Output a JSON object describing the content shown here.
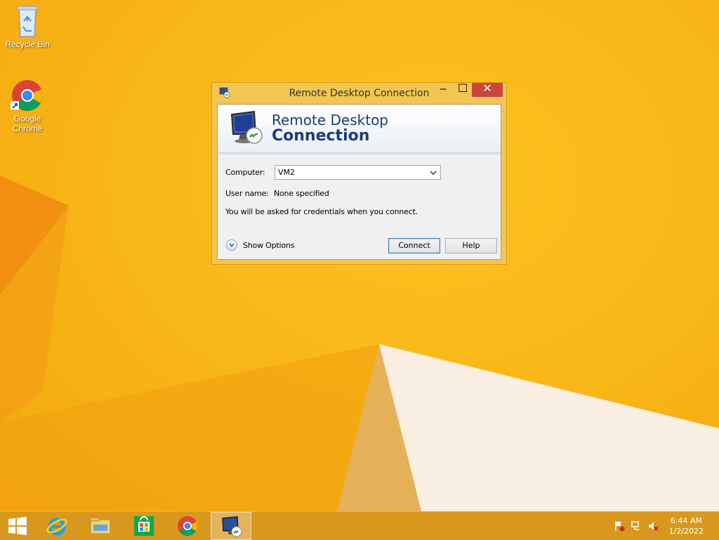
{
  "desktop": {
    "icons": [
      {
        "label": "Recycle Bin",
        "icon": "recycle-bin-icon"
      },
      {
        "label": "Google Chrome",
        "icon": "chrome-icon"
      }
    ]
  },
  "window": {
    "title": "Remote Desktop Connection",
    "banner_line1": "Remote Desktop",
    "banner_line2": "Connection",
    "computer_label": "Computer:",
    "computer_value": "VM2",
    "username_label": "User name:",
    "username_value": "None specified",
    "info_text": "You will be asked for credentials when you connect.",
    "show_options_label": "Show Options",
    "connect_label": "Connect",
    "help_label": "Help",
    "controls": {
      "minimize": "–",
      "maximize": "☐",
      "close": "✕"
    }
  },
  "taskbar": {
    "items": [
      "start-icon",
      "internet-explorer-icon",
      "file-explorer-icon",
      "store-icon",
      "chrome-icon",
      "remote-desktop-icon"
    ],
    "active_item": "remote-desktop-icon",
    "tray": [
      "action-center-flag-icon",
      "network-icon",
      "volume-muted-icon"
    ],
    "time": "6:44 AM",
    "date": "1/2/2022"
  },
  "colors": {
    "wallpaper": "#f9b818",
    "taskbar": "#d6971e",
    "close_button": "#c9463d",
    "banner_text": "#1c3d7a"
  }
}
